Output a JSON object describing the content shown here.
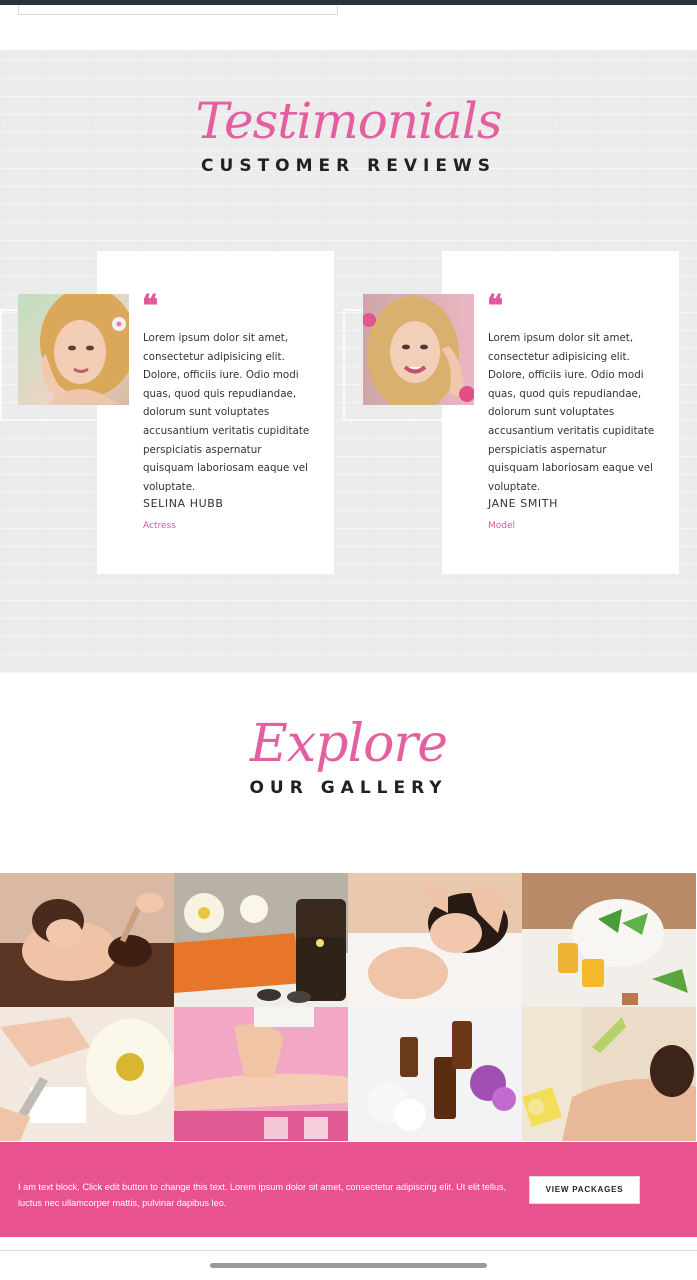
{
  "testimonials": {
    "script_title": "Testimonials",
    "heading": "CUSTOMER REVIEWS",
    "items": [
      {
        "quote_mark": "❝",
        "text": "Lorem ipsum dolor sit amet, consectetur adipisicing elit. Dolore, officiis iure. Odio modi quas, quod quis repudiandae, dolorum sunt voluptates accusantium veritatis cupiditate perspiciatis aspernatur quisquam laboriosam eaque vel voluptate.",
        "name": "SELINA HUBB",
        "role": "Actress"
      },
      {
        "quote_mark": "❝",
        "text": "Lorem ipsum dolor sit amet, consectetur adipisicing elit. Dolore, officiis iure. Odio modi quas, quod quis repudiandae, dolorum sunt voluptates accusantium veritatis cupiditate perspiciatis aspernatur quisquam laboriosam eaque vel voluptate.",
        "name": "JANE SMITH",
        "role": "Model"
      }
    ]
  },
  "gallery": {
    "script_title": "Explore",
    "heading": "OUR GALLERY",
    "photos": [
      "spa-chocolate-massage-photo",
      "candles-orchids-towels-photo",
      "facial-massage-photo",
      "herbal-mortar-oils-photo",
      "manicure-flower-photo",
      "leg-waxing-candles-photo",
      "essential-oil-bottles-photo",
      "back-massage-oil-photo"
    ]
  },
  "cta": {
    "text": "I am text block. Click edit button to change this text. Lorem ipsum dolor sit amet, consectetur adipiscing elit. Ut elit tellus, luctus nec ullamcorper mattis, pulvinar dapibus leo.",
    "button_label": "VIEW PACKAGES"
  },
  "colors": {
    "accent": "#e0579b",
    "cta_background": "#e8528f",
    "heading": "#222222",
    "section_background": "#ececec"
  }
}
